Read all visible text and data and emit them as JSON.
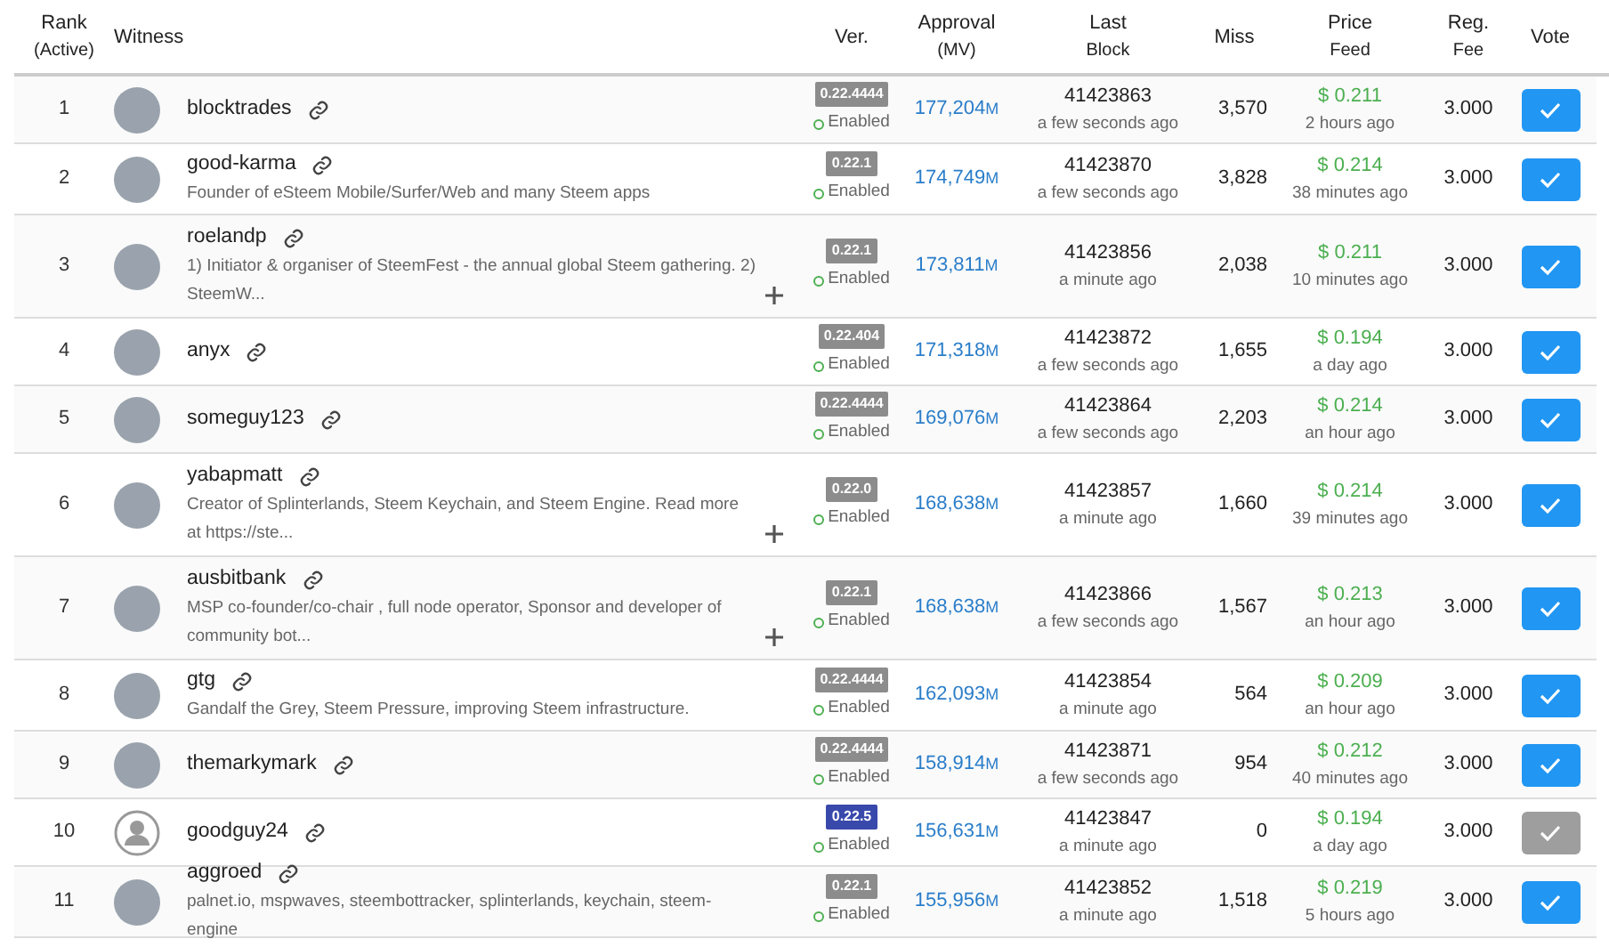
{
  "table": {
    "columns": [
      {
        "label": "Rank",
        "sublabel": "(Active)"
      },
      {
        "label": "Witness"
      },
      {
        "label": "Ver."
      },
      {
        "label": "Approval",
        "sublabel": "(MV)"
      },
      {
        "label": "Last",
        "sublabel": "Block"
      },
      {
        "label": "Miss"
      },
      {
        "label": "Price",
        "sublabel": "Feed"
      },
      {
        "label": "Reg.",
        "sublabel": "Fee"
      },
      {
        "label": "Vote"
      }
    ],
    "rows": [
      {
        "rank": "1",
        "avatar": {
          "kind": "photo"
        },
        "name": "blocktrades",
        "version": {
          "label": "0.22.4444",
          "color": "#8c8c8c"
        },
        "status": "Enabled",
        "approval": "177,204",
        "approval_unit": "M",
        "last_block": "41423863",
        "last_block_time": "a few seconds ago",
        "miss": "3,570",
        "price": "$ 0.211",
        "price_time": "2 hours ago",
        "reg_fee": "3.000",
        "voted": true
      },
      {
        "rank": "2",
        "avatar": {
          "kind": "photo"
        },
        "name": "good-karma",
        "description": "Founder of eSteem Mobile/Surfer/Web and many Steem apps",
        "truncated": false,
        "version": {
          "label": "0.22.1",
          "color": "#8c8c8c"
        },
        "status": "Enabled",
        "approval": "174,749",
        "approval_unit": "M",
        "last_block": "41423870",
        "last_block_time": "a few seconds ago",
        "miss": "3,828",
        "price": "$ 0.214",
        "price_time": "38 minutes ago",
        "reg_fee": "3.000",
        "voted": true
      },
      {
        "rank": "3",
        "avatar": {
          "kind": "photo"
        },
        "name": "roelandp",
        "description": "1) Initiator & organiser of SteemFest - the annual global Steem gathering. 2) SteemW...",
        "truncated": true,
        "version": {
          "label": "0.22.1",
          "color": "#8c8c8c"
        },
        "status": "Enabled",
        "approval": "173,811",
        "approval_unit": "M",
        "last_block": "41423856",
        "last_block_time": "a minute ago",
        "miss": "2,038",
        "price": "$ 0.211",
        "price_time": "10 minutes ago",
        "reg_fee": "3.000",
        "voted": true
      },
      {
        "rank": "4",
        "avatar": {
          "kind": "photo"
        },
        "name": "anyx",
        "version": {
          "label": "0.22.404",
          "color": "#8c8c8c"
        },
        "status": "Enabled",
        "approval": "171,318",
        "approval_unit": "M",
        "last_block": "41423872",
        "last_block_time": "a few seconds ago",
        "miss": "1,655",
        "price": "$ 0.194",
        "price_time": "a day ago",
        "reg_fee": "3.000",
        "voted": true
      },
      {
        "rank": "5",
        "avatar": {
          "kind": "photo"
        },
        "name": "someguy123",
        "version": {
          "label": "0.22.4444",
          "color": "#8c8c8c"
        },
        "status": "Enabled",
        "approval": "169,076",
        "approval_unit": "M",
        "last_block": "41423864",
        "last_block_time": "a few seconds ago",
        "miss": "2,203",
        "price": "$ 0.214",
        "price_time": "an hour ago",
        "reg_fee": "3.000",
        "voted": true
      },
      {
        "rank": "6",
        "avatar": {
          "kind": "photo"
        },
        "name": "yabapmatt",
        "description": "Creator of Splinterlands, Steem Keychain, and Steem Engine. Read more at https://ste...",
        "truncated": true,
        "version": {
          "label": "0.22.0",
          "color": "#8c8c8c"
        },
        "status": "Enabled",
        "approval": "168,638",
        "approval_unit": "M",
        "last_block": "41423857",
        "last_block_time": "a minute ago",
        "miss": "1,660",
        "price": "$ 0.214",
        "price_time": "39 minutes ago",
        "reg_fee": "3.000",
        "voted": true
      },
      {
        "rank": "7",
        "avatar": {
          "kind": "photo"
        },
        "name": "ausbitbank",
        "description": "MSP co-founder/co-chair , full node operator, Sponsor and developer of community bot...",
        "truncated": true,
        "version": {
          "label": "0.22.1",
          "color": "#8c8c8c"
        },
        "status": "Enabled",
        "approval": "168,638",
        "approval_unit": "M",
        "last_block": "41423866",
        "last_block_time": "a few seconds ago",
        "miss": "1,567",
        "price": "$ 0.213",
        "price_time": "an hour ago",
        "reg_fee": "3.000",
        "voted": true
      },
      {
        "rank": "8",
        "avatar": {
          "kind": "photo"
        },
        "name": "gtg",
        "description": "Gandalf the Grey, Steem Pressure, improving Steem infrastructure.",
        "truncated": false,
        "version": {
          "label": "0.22.4444",
          "color": "#8c8c8c"
        },
        "status": "Enabled",
        "approval": "162,093",
        "approval_unit": "M",
        "last_block": "41423854",
        "last_block_time": "a minute ago",
        "miss": "564",
        "price": "$ 0.209",
        "price_time": "an hour ago",
        "reg_fee": "3.000",
        "voted": true
      },
      {
        "rank": "9",
        "avatar": {
          "kind": "photo"
        },
        "name": "themarkymark",
        "version": {
          "label": "0.22.4444",
          "color": "#8c8c8c"
        },
        "status": "Enabled",
        "approval": "158,914",
        "approval_unit": "M",
        "last_block": "41423871",
        "last_block_time": "a few seconds ago",
        "miss": "954",
        "price": "$ 0.212",
        "price_time": "40 minutes ago",
        "reg_fee": "3.000",
        "voted": true
      },
      {
        "rank": "10",
        "avatar": {
          "kind": "default"
        },
        "name": "goodguy24",
        "version": {
          "label": "0.22.5",
          "color": "#3949ab"
        },
        "status": "Enabled",
        "approval": "156,631",
        "approval_unit": "M",
        "last_block": "41423847",
        "last_block_time": "a minute ago",
        "miss": "0",
        "price": "$ 0.194",
        "price_time": "a day ago",
        "reg_fee": "3.000",
        "voted": false
      },
      {
        "rank": "11",
        "avatar": {
          "kind": "photo"
        },
        "name": "aggroed",
        "description": "palnet.io, mspwaves, steembottracker, splinterlands, keychain, steem-engine",
        "truncated": false,
        "version": {
          "label": "0.22.1",
          "color": "#8c8c8c"
        },
        "status": "Enabled",
        "approval": "155,956",
        "approval_unit": "M",
        "last_block": "41423852",
        "last_block_time": "a minute ago",
        "miss": "1,518",
        "price": "$ 0.219",
        "price_time": "5 hours ago",
        "reg_fee": "3.000",
        "voted": true
      }
    ]
  }
}
